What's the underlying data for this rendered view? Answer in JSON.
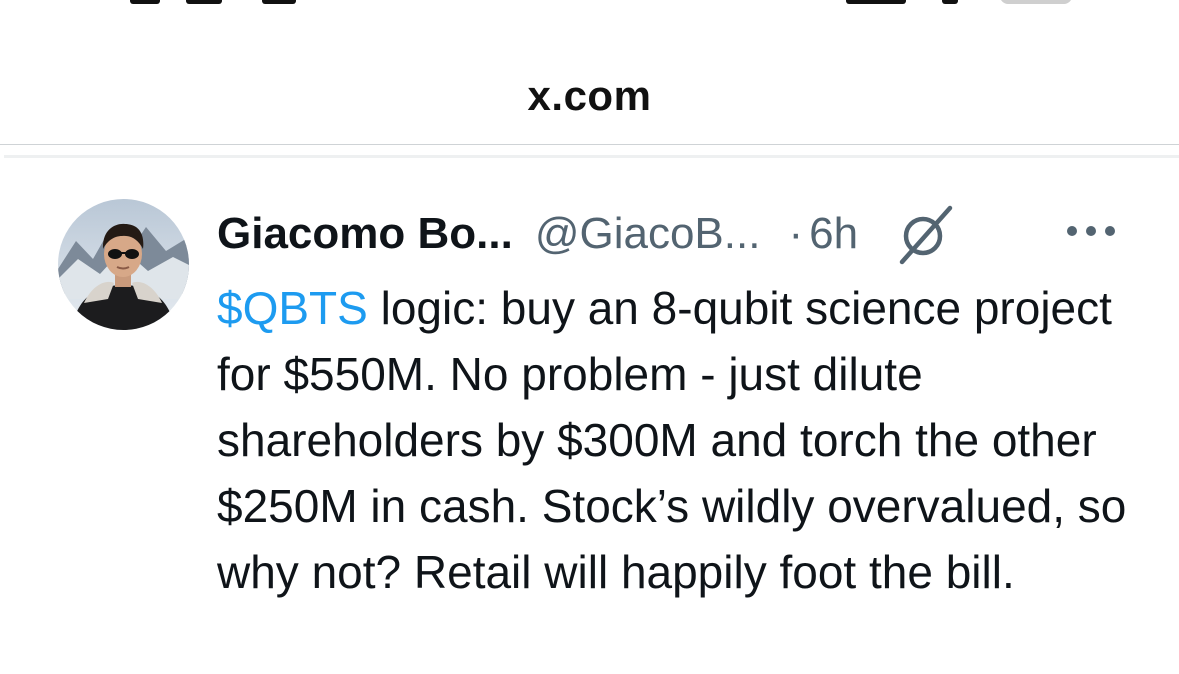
{
  "browser": {
    "url_display": "x.com"
  },
  "tweet": {
    "author_name": "Giacomo Bo...",
    "author_handle": "@GiacoB...",
    "separator": "·",
    "time_ago": "6h",
    "icons": {
      "grok": "grok-icon",
      "more": "more-icon",
      "avatar": "avatar"
    },
    "text": {
      "cashtag": "$QBTS",
      "body": " logic: buy an 8-qubit science project for $550M. No problem - just dilute shareholders by $300M and torch the other $250M in cash. Stock’s wildly overvalued, so why not? Retail will happily foot the bill."
    },
    "colors": {
      "cashtag": "#1d9bf0",
      "secondary_text": "#536471",
      "primary_text": "#0f1419"
    }
  }
}
